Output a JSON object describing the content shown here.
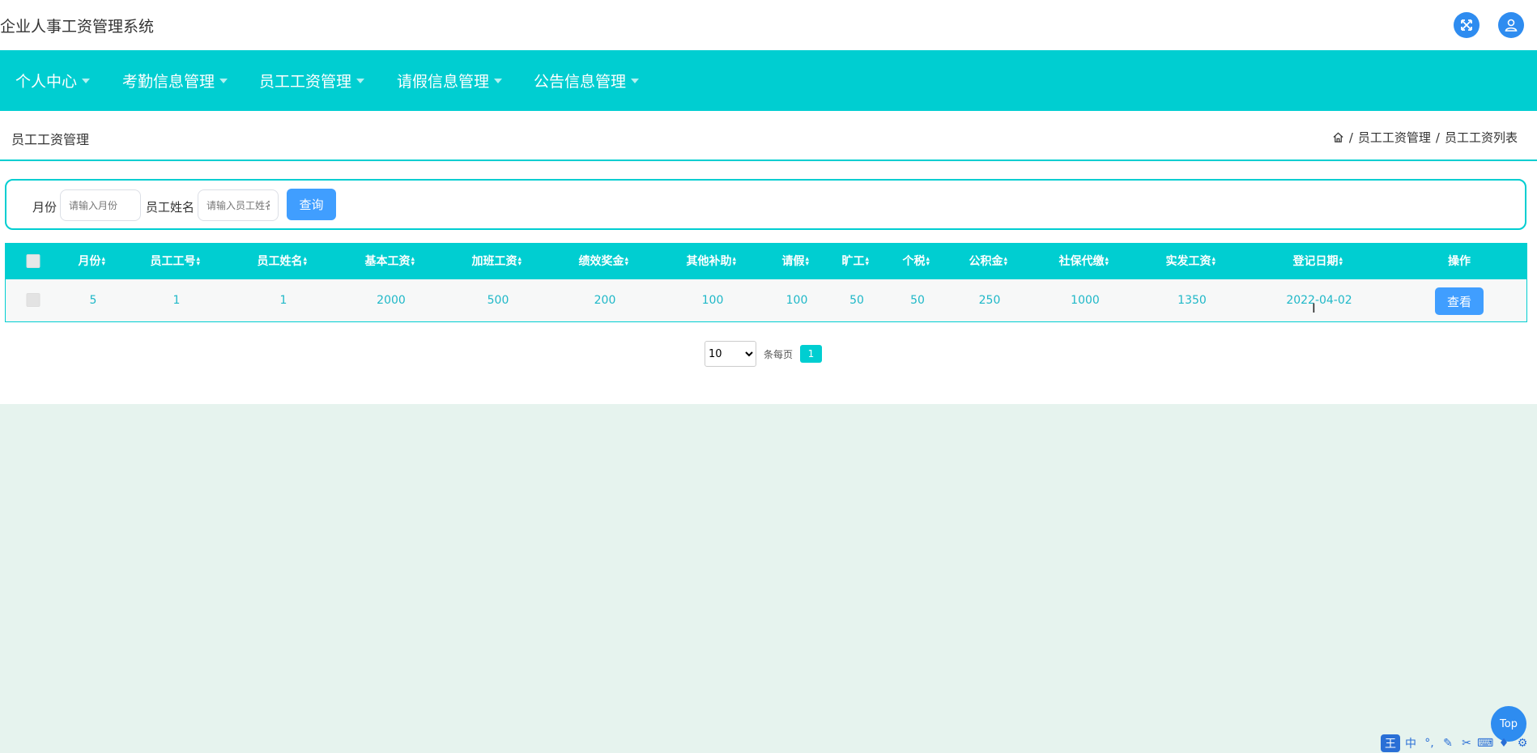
{
  "app": {
    "title": "企业人事工资管理系统"
  },
  "nav": [
    {
      "label": "个人中心"
    },
    {
      "label": "考勤信息管理"
    },
    {
      "label": "员工工资管理"
    },
    {
      "label": "请假信息管理"
    },
    {
      "label": "公告信息管理"
    }
  ],
  "page": {
    "title": "员工工资管理",
    "breadcrumb": [
      "/",
      "员工工资管理",
      "/",
      "员工工资列表"
    ]
  },
  "search": {
    "month_label": "月份",
    "month_placeholder": "请输入月份",
    "name_label": "员工姓名",
    "name_placeholder": "请输入员工姓名",
    "button": "查询"
  },
  "table": {
    "columns": [
      "月份",
      "员工工号",
      "员工姓名",
      "基本工资",
      "加班工资",
      "绩效奖金",
      "其他补助",
      "请假",
      "旷工",
      "个税",
      "公积金",
      "社保代缴",
      "实发工资",
      "登记日期",
      "操作"
    ],
    "rows": [
      [
        "5",
        "1",
        "1",
        "2000",
        "500",
        "200",
        "100",
        "100",
        "50",
        "50",
        "250",
        "1000",
        "1350",
        "2022-04-02"
      ]
    ],
    "action_label": "查看"
  },
  "pagination": {
    "page_size": "10",
    "page_size_options": [
      "10"
    ],
    "per_page_label": "条每页",
    "current_page": "1"
  },
  "back_to_top": "Top",
  "ime": {
    "logo": "王",
    "lang": "中"
  },
  "colors": {
    "primary": "#00ced1",
    "button": "#409eff",
    "icon": "#2e8cf0",
    "background": "#e6f3ee"
  }
}
